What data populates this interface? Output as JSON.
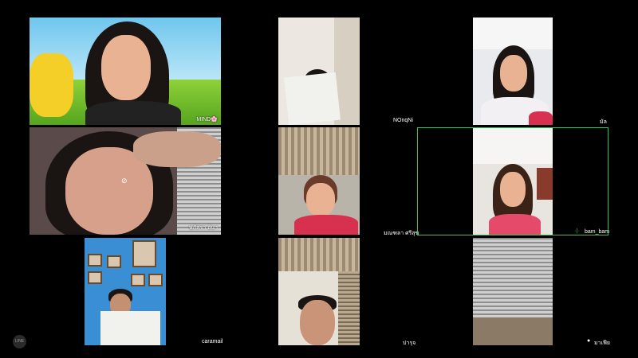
{
  "participants": [
    {
      "name": "MIND🌸",
      "speaking": false
    },
    {
      "name": "NOnqNi",
      "speaking": false
    },
    {
      "name": "มัล",
      "speaking": false
    },
    {
      "name": "ษภัสรา อินา",
      "speaking": false,
      "camera_off_icon": true
    },
    {
      "name": "มณฑลา ศรีสุข",
      "speaking": false
    },
    {
      "name": "bam_bam",
      "speaking": true
    },
    {
      "name": "caramail",
      "speaking": false
    },
    {
      "name": "ปารุจ",
      "speaking": false
    },
    {
      "name": "มาเฟีย",
      "speaking": false,
      "mic_icon": true
    }
  ],
  "colors": {
    "speaking_border": "#2fc25b",
    "background": "#000000"
  },
  "icons": {
    "speaking": "sound-wave-icon",
    "camera_off": "camera-off-icon",
    "mic": "microphone-icon",
    "app": "line-logo-icon"
  },
  "app_logo_text": "LINE"
}
